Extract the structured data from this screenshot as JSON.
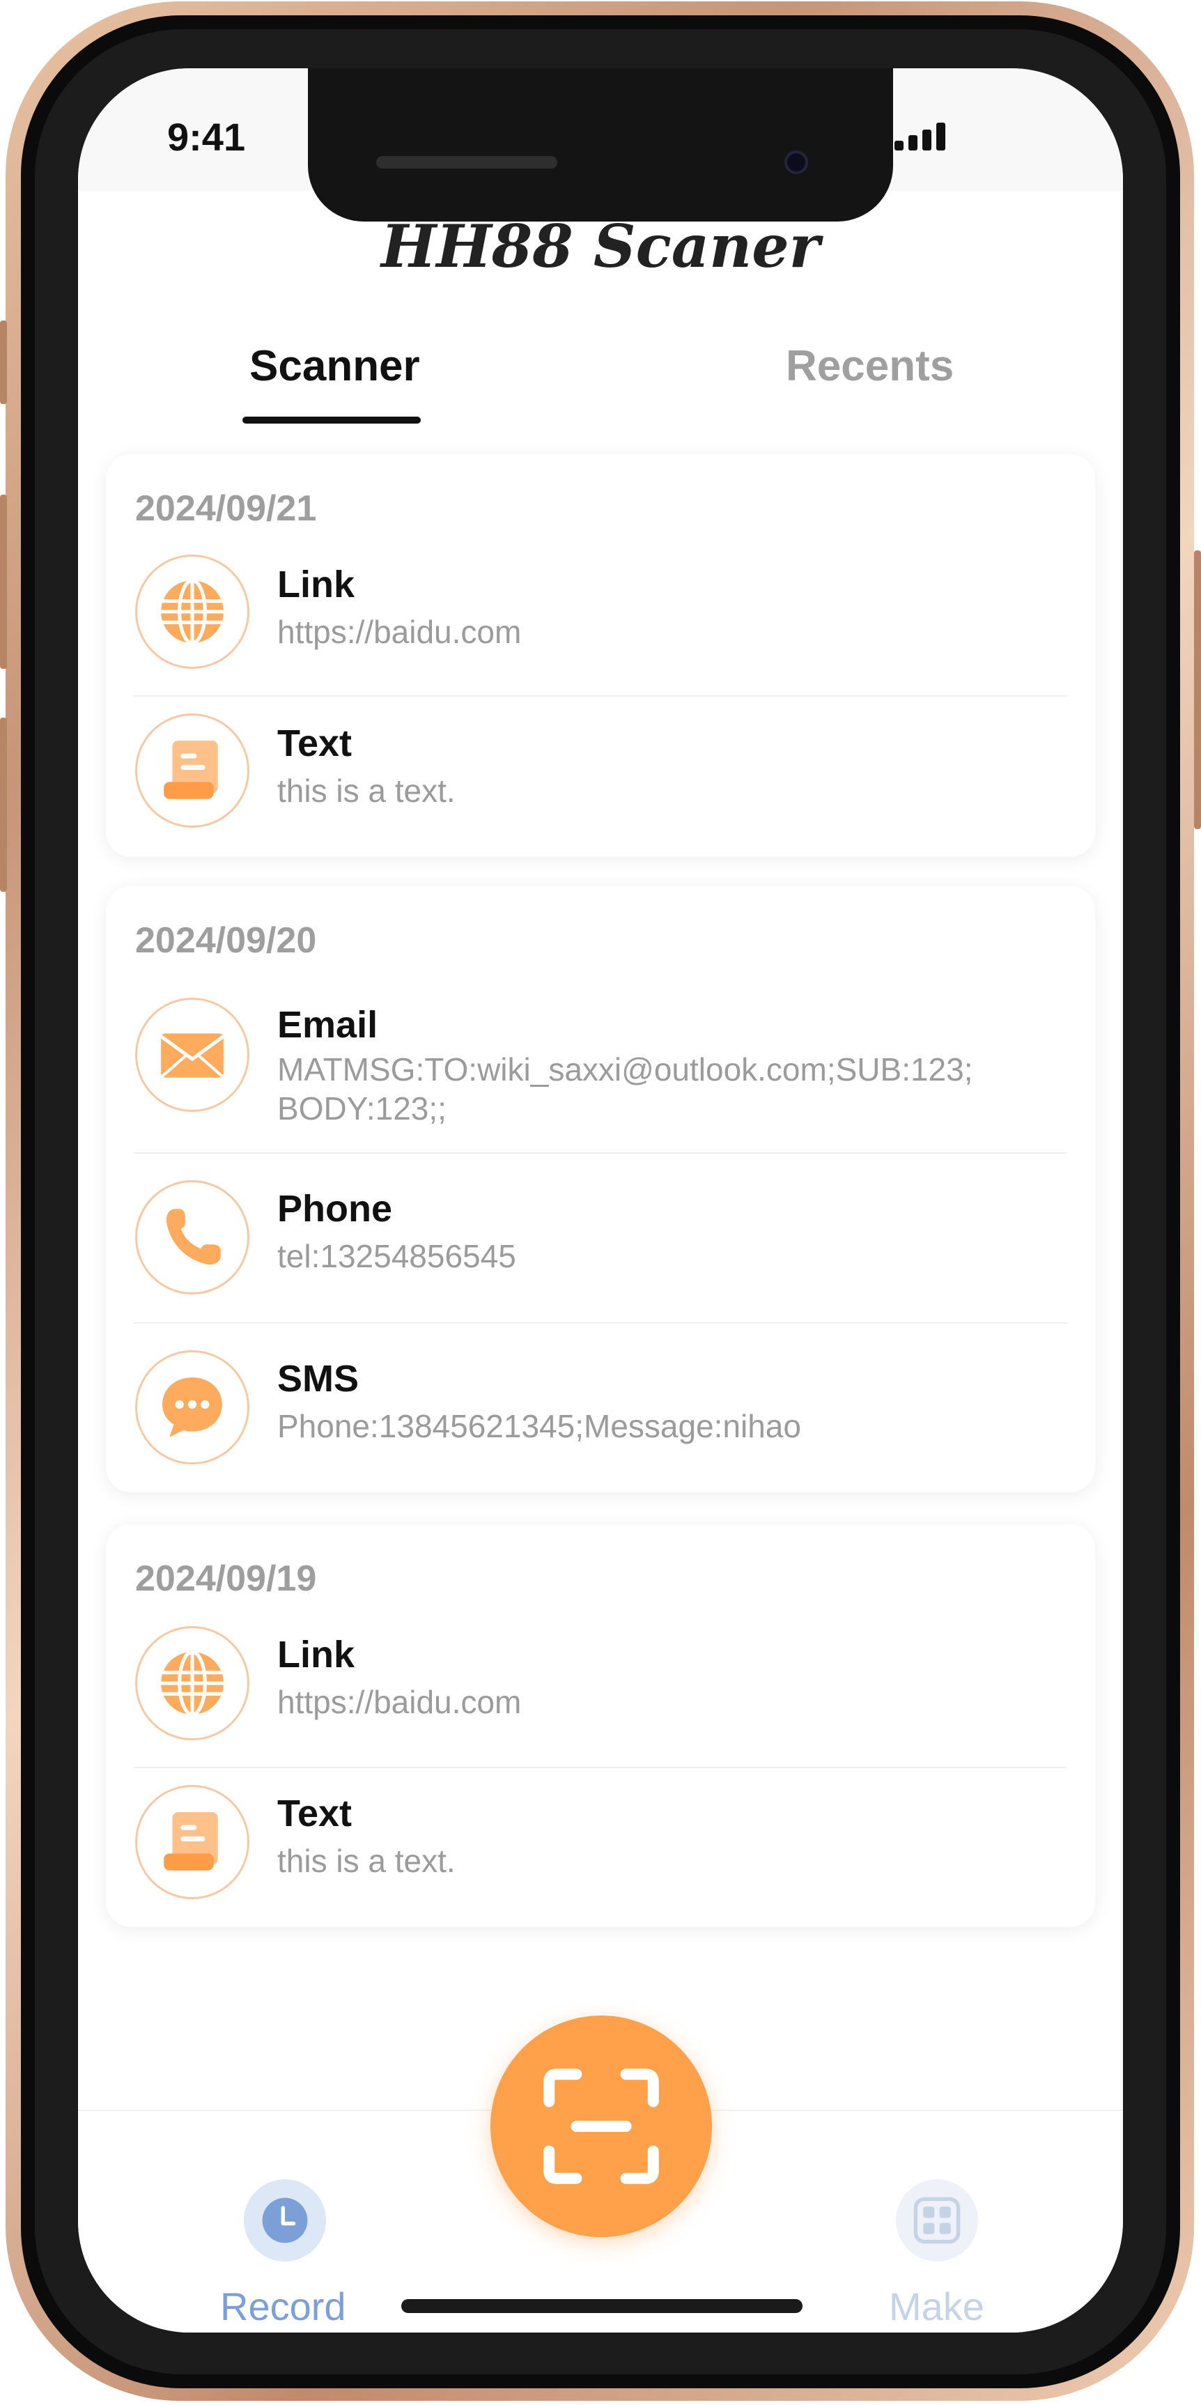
{
  "status_bar": {
    "time": "9:41"
  },
  "app": {
    "title": "HH88 Scaner"
  },
  "tabs": [
    {
      "label": "Scanner",
      "active": true
    },
    {
      "label": "Recents",
      "active": false
    }
  ],
  "groups": [
    {
      "date": "2024/09/21",
      "items": [
        {
          "icon": "globe-icon",
          "title": "Link",
          "detail": "https://baidu.com"
        },
        {
          "icon": "document-icon",
          "title": "Text",
          "detail": "this is a text."
        }
      ]
    },
    {
      "date": "2024/09/20",
      "items": [
        {
          "icon": "envelope-icon",
          "title": "Email",
          "detail_line1": "MATMSG:TO:wiki_saxxi@outlook.com;SUB:123;",
          "detail_line2": "BODY:123;;"
        },
        {
          "icon": "phone-icon",
          "title": "Phone",
          "detail": "tel:13254856545"
        },
        {
          "icon": "chat-bubble-icon",
          "title": "SMS",
          "detail": "Phone:13845621345;Message:nihao"
        }
      ]
    },
    {
      "date": "2024/09/19",
      "items": [
        {
          "icon": "globe-icon",
          "title": "Link",
          "detail": "https://baidu.com"
        },
        {
          "icon": "document-icon",
          "title": "Text",
          "detail": "this is a text."
        }
      ]
    }
  ],
  "bottom_nav": {
    "record": {
      "label": "Record",
      "icon": "clock-icon",
      "active": true
    },
    "scan": {
      "icon": "scan-icon"
    },
    "make": {
      "label": "Make",
      "icon": "grid-icon",
      "active": false
    }
  },
  "colors": {
    "accent": "#ffa04a",
    "record_active": "#7b9fd6",
    "make_inactive": "#c5d3e6",
    "icon_border": "#f6c9a4"
  }
}
